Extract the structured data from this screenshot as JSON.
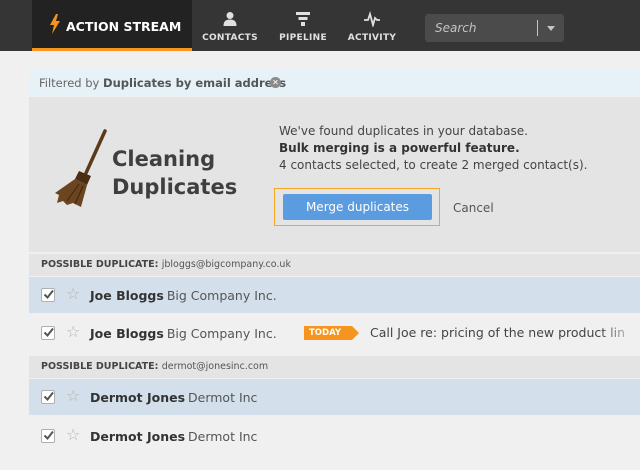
{
  "topnav": {
    "brand_label": "ACTION STREAM",
    "items": [
      {
        "label": "CONTACTS",
        "icon": "person-icon"
      },
      {
        "label": "PIPELINE",
        "icon": "filter-icon"
      },
      {
        "label": "ACTIVITY",
        "icon": "pulse-icon"
      }
    ],
    "search_placeholder": "Search",
    "accent_color": "#f5941e"
  },
  "filter": {
    "prefix": "Filtered by",
    "value": "Duplicates by email address",
    "clear_icon": "clear-filter-icon"
  },
  "banner": {
    "title_line1": "Cleaning",
    "title_line2": "Duplicates",
    "message_line1": "We've found duplicates in your database.",
    "message_line2": "Bulk merging is a powerful feature.",
    "message_line3": "4 contacts selected, to create 2 merged contact(s).",
    "merge_button": "Merge duplicates",
    "cancel_link": "Cancel",
    "button_color": "#5b9be0"
  },
  "groups": [
    {
      "label": "POSSIBLE DUPLICATE:",
      "email": "jbloggs@bigcompany.co.uk",
      "rows": [
        {
          "name": "Joe Bloggs",
          "company": "Big Company Inc.",
          "checked": true
        },
        {
          "name": "Joe Bloggs",
          "company": "Big Company Inc.",
          "checked": true,
          "badge": "TODAY",
          "task": "Call Joe re: pricing of the new product lin"
        }
      ]
    },
    {
      "label": "POSSIBLE DUPLICATE:",
      "email": "dermot@jonesinc.com",
      "rows": [
        {
          "name": "Dermot Jones",
          "company": "Dermot Inc",
          "checked": true
        },
        {
          "name": "Dermot Jones",
          "company": "Dermot Inc",
          "checked": true
        }
      ]
    }
  ]
}
